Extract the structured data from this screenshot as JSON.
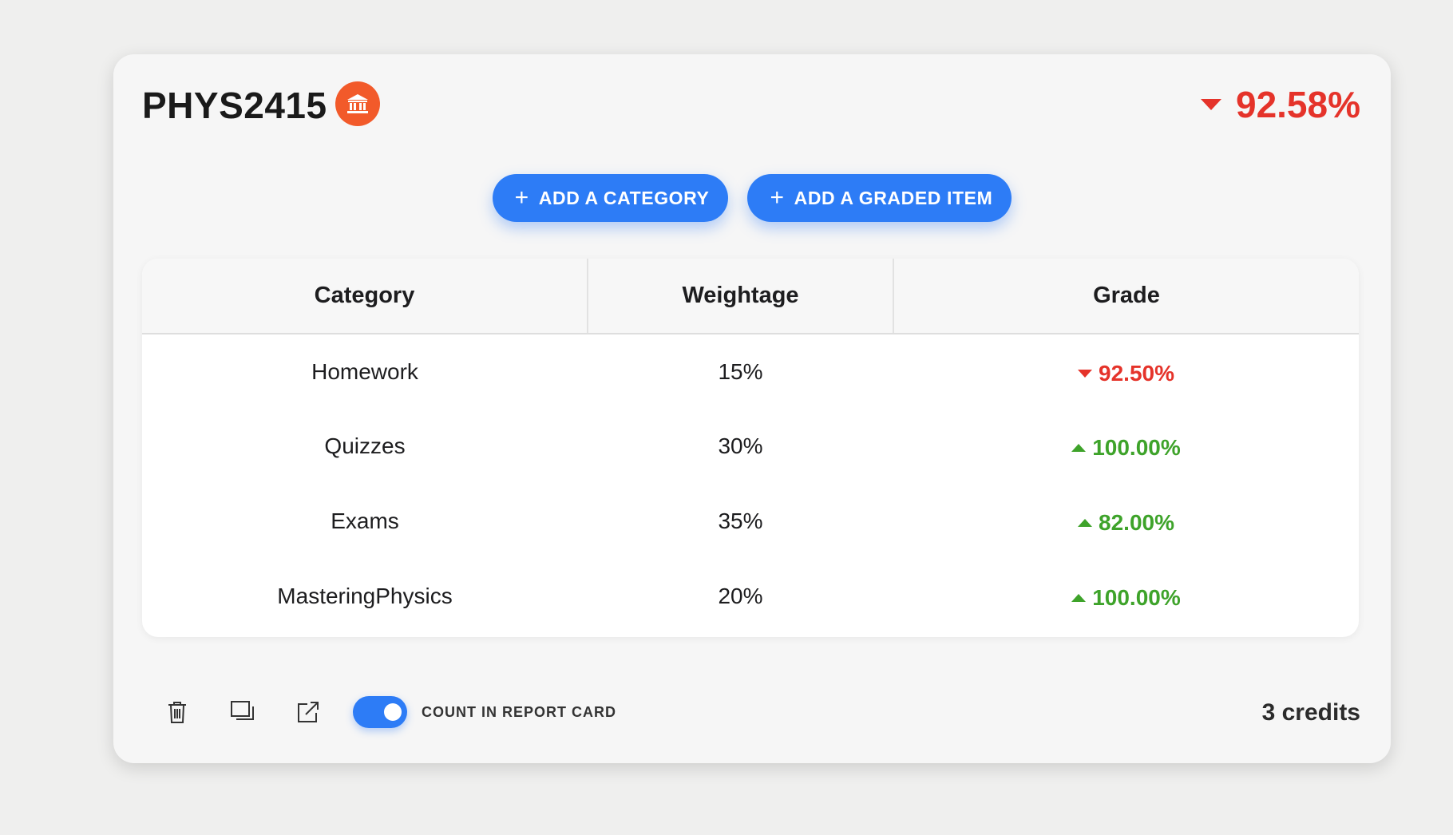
{
  "course": {
    "code": "PHYS2415",
    "icon": "institution-icon",
    "icon_color": "#f25a2a",
    "overall_grade": "92.58%",
    "overall_trend": "down"
  },
  "actions": {
    "add_category_label": "ADD A CATEGORY",
    "add_graded_item_label": "ADD A GRADED ITEM"
  },
  "table": {
    "headers": [
      "Category",
      "Weightage",
      "Grade"
    ],
    "rows": [
      {
        "category": "Homework",
        "weightage": "15%",
        "grade": "92.50%",
        "trend": "down"
      },
      {
        "category": "Quizzes",
        "weightage": "30%",
        "grade": "100.00%",
        "trend": "up"
      },
      {
        "category": "Exams",
        "weightage": "35%",
        "grade": "82.00%",
        "trend": "up"
      },
      {
        "category": "MasteringPhysics",
        "weightage": "20%",
        "grade": "100.00%",
        "trend": "up"
      }
    ]
  },
  "footer": {
    "icons": [
      "trash-icon",
      "duplicate-icon",
      "open-external-icon"
    ],
    "toggle_label": "COUNT IN REPORT CARD",
    "toggle_on": true,
    "credits": "3 credits"
  },
  "colors": {
    "accent": "#2d7cf6",
    "negative": "#e5332a",
    "positive": "#3ea32a"
  }
}
